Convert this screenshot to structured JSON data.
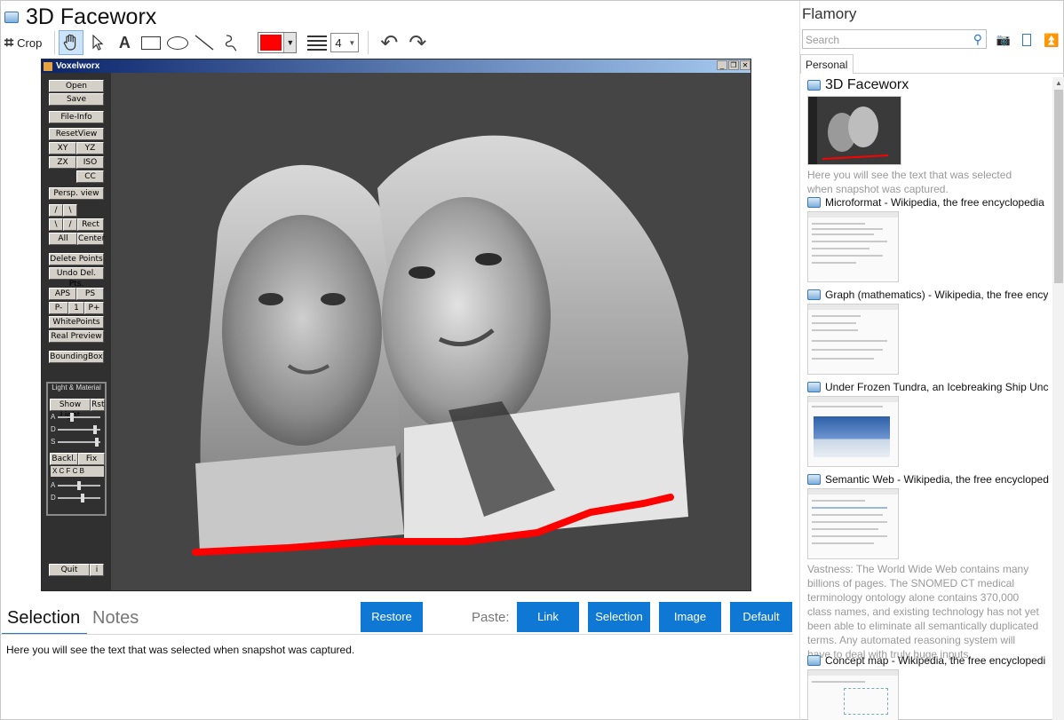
{
  "app": {
    "title": "3D Faceworx"
  },
  "toolbar": {
    "crop_label": "Crop",
    "color": "#ff0000",
    "line_width": "4",
    "tools": [
      "hand",
      "pointer",
      "text",
      "rectangle",
      "ellipse",
      "line",
      "freehand"
    ]
  },
  "snapshot": {
    "window_title": "Voxelworx",
    "buttons": {
      "open": "Open",
      "save": "Save",
      "file_info": "File-Info",
      "reset_view": "ResetView",
      "xy": "XY",
      "yz": "YZ",
      "zx": "ZX",
      "iso": "ISO",
      "cc": "CC",
      "persp_view": "Persp. view",
      "sel1": "/",
      "sel2": "\\",
      "sel3": "\\",
      "sel4": "/",
      "rect": "Rect",
      "all": "All",
      "center": "Center",
      "delete_points": "Delete Points",
      "undo_del_pts": "Undo Del. Pts.",
      "aps": "APS",
      "ps": "PS",
      "p_minus": "P-",
      "one": "1",
      "p_plus": "P+",
      "white_points": "WhitePoints",
      "real_preview": "Real Preview",
      "bounding_box": "BoundingBox",
      "show_light": "Show Light",
      "rst": "Rst",
      "backl": "Backl.",
      "fix": "Fix",
      "quit": "Quit",
      "info": "i"
    },
    "light_material": {
      "title": "Light & Material",
      "slider_a": "A",
      "slider_d": "D",
      "slider_s": "S",
      "radios": "X C F C B",
      "slider_a2": "A",
      "slider_d2": "D"
    }
  },
  "notes": {
    "tabs": [
      "Selection",
      "Notes"
    ],
    "active_tab": "Selection",
    "restore_label": "Restore",
    "paste_label": "Paste:",
    "paste_buttons": [
      "Link",
      "Selection",
      "Image",
      "Default"
    ],
    "selection_text": "Here you will see the text that was selected when snapshot was captured."
  },
  "sidebar": {
    "brand": "Flamory",
    "search_placeholder": "Search",
    "tab": "Personal",
    "entries": [
      {
        "title": "3D Faceworx",
        "desc": "Here you will see the text that was selected when snapshot was captured."
      },
      {
        "title": "Microformat - Wikipedia, the free encyclopedia"
      },
      {
        "title": "Graph (mathematics) - Wikipedia, the free ency"
      },
      {
        "title": "Under Frozen Tundra, an Icebreaking Ship Unco"
      },
      {
        "title": "Semantic Web - Wikipedia, the free encycloped",
        "desc": "Vastness: The World Wide Web contains many billions of pages. The SNOMED CT medical terminology ontology alone contains 370,000 class names, and existing technology has not yet been able to eliminate all semantically duplicated terms. Any automated reasoning system will have to deal with truly huge inputs."
      },
      {
        "title": "Concept map - Wikipedia, the free encyclopedi"
      }
    ]
  },
  "colors": {
    "accent": "#0e78d4",
    "marker": "#ff0000"
  }
}
